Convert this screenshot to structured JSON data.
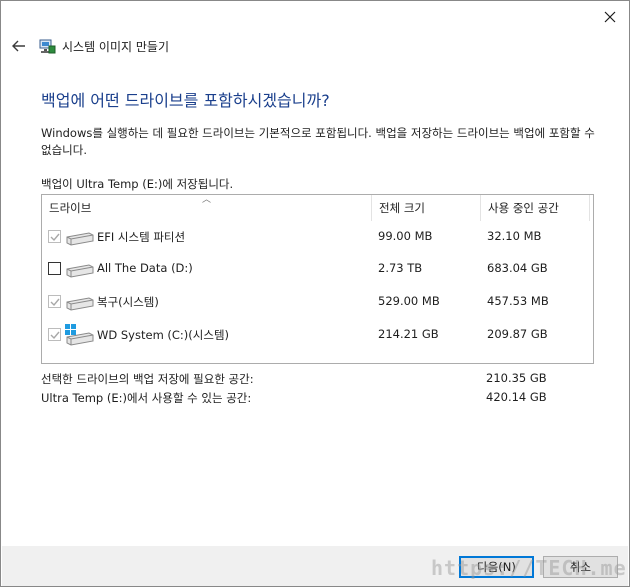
{
  "window": {
    "title": "시스템 이미지 만들기"
  },
  "heading": "백업에 어떤 드라이브를 포함하시겠습니까?",
  "description": "Windows를 실행하는 데 필요한 드라이브는 기본적으로 포함됩니다. 백업을 저장하는 드라이브는 백업에 포함할 수 없습니다.",
  "save_target": "백업이 Ultra Temp (E:)에 저장됩니다.",
  "table": {
    "headers": [
      "드라이브",
      "전체 크기",
      "사용 중인 공간"
    ],
    "rows": [
      {
        "name": "EFI 시스템 파티션",
        "total": "99.00 MB",
        "used": "32.10 MB",
        "checked": true,
        "disabled": true,
        "icon": "drive-icon"
      },
      {
        "name": "All The Data (D:)",
        "total": "2.73 TB",
        "used": "683.04 GB",
        "checked": false,
        "disabled": false,
        "icon": "drive-icon"
      },
      {
        "name": "복구(시스템)",
        "total": "529.00 MB",
        "used": "457.53 MB",
        "checked": true,
        "disabled": true,
        "icon": "drive-icon"
      },
      {
        "name": "WD System (C:)(시스템)",
        "total": "214.21 GB",
        "used": "209.87 GB",
        "checked": true,
        "disabled": true,
        "icon": "windows-drive-icon"
      }
    ]
  },
  "summary": {
    "required_label": "선택한 드라이브의 백업 저장에 필요한 공간:",
    "required_value": "210.35 GB",
    "available_label": "Ultra Temp (E:)에서 사용할 수 있는 공간:",
    "available_value": "420.14 GB"
  },
  "buttons": {
    "next": "다음(N)",
    "cancel": "취소"
  },
  "watermark": "https://TECH.me",
  "colors": {
    "heading": "#1a3f8c",
    "primary_border": "#0078d7",
    "footer_bg": "#f0f0f0"
  }
}
